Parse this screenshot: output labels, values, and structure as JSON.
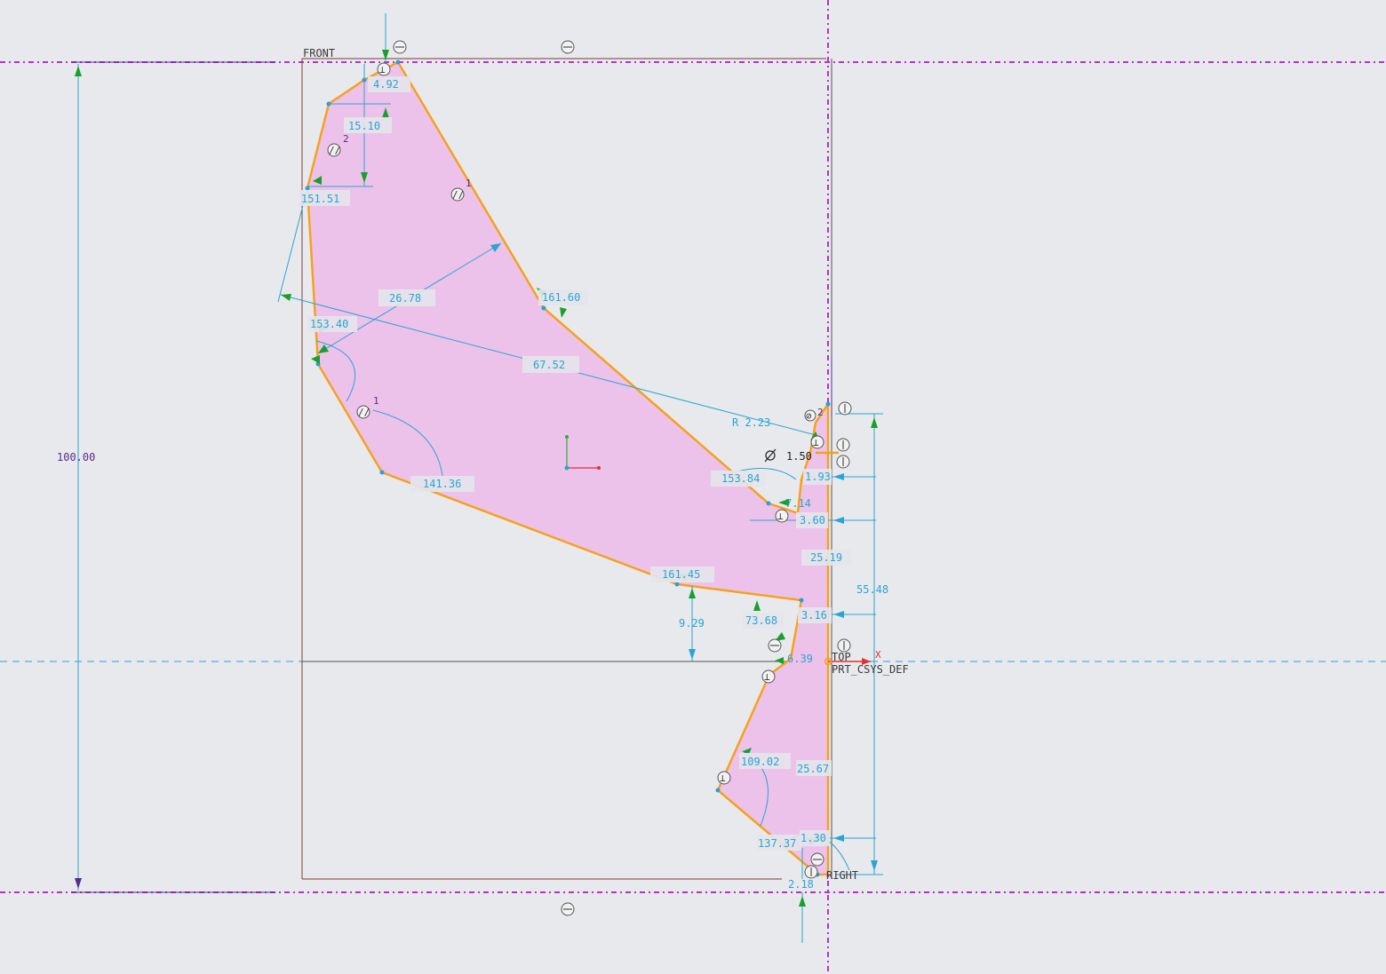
{
  "planes": {
    "front": "FRONT",
    "top": "TOP",
    "right": "RIGHT",
    "csys": "PRT_CSYS_DEF",
    "x_axis": "X"
  },
  "constraint_labels": {
    "c2": "2",
    "c1a": "1",
    "c1b": "1",
    "c2b": "2"
  },
  "dimensions": {
    "d_100": "100.00",
    "d_4_92": "4.92",
    "d_15_10": "15.10",
    "d_151": "151.51",
    "d_26_78": "26.78",
    "d_161_60": "161.60",
    "d_153_40": "153.40",
    "d_67_52": "67.52",
    "d_141_36": "141.36",
    "d_r223": "R 2.23",
    "d_phi": "1.50",
    "d_153_84": "153.84",
    "d_1_93": "1.93",
    "d_7_14": "7.14",
    "d_3_60": "3.60",
    "d_25_19": "25.19",
    "d_55_48": "55.48",
    "d_161_45": "161.45",
    "d_9_29": "9.29",
    "d_73_68": "73.68",
    "d_3_16": "3.16",
    "d_6_39": "6.39",
    "d_109_02": "109.02",
    "d_25_67": "25.67",
    "d_137_37": "137.37",
    "d_1_30": "1.30",
    "d_2_18": "2.18"
  },
  "colors": {
    "background": "#e8e9ed",
    "section_fill": "#edc2ea",
    "section_edge": "#f5a11e",
    "dimension": "#2aa4d2",
    "datum": "#b232c8",
    "arrow": "#18a02c"
  },
  "icons": {
    "parallel": "parallel-constraint-icon",
    "perpendicular": "perpendicular-constraint-icon",
    "horizontal": "horizontal-constraint-icon",
    "vertical": "vertical-constraint-icon",
    "diameter": "diameter-symbol-icon"
  }
}
